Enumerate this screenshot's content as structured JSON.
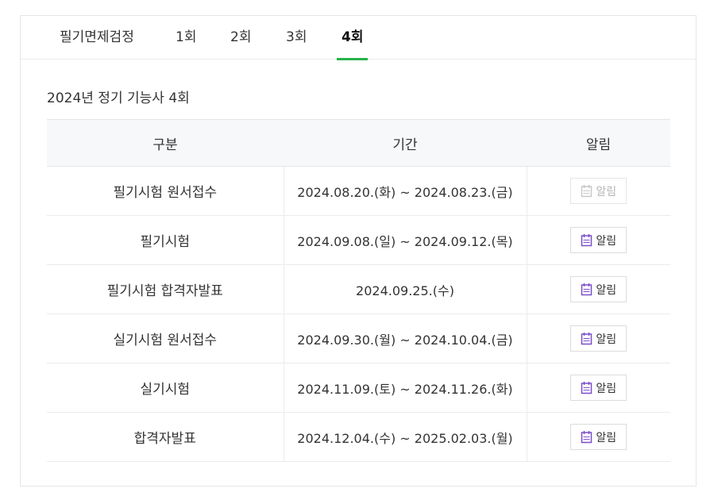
{
  "tabs": [
    {
      "label": "필기면제검정",
      "active": false
    },
    {
      "label": "1회",
      "active": false
    },
    {
      "label": "2회",
      "active": false
    },
    {
      "label": "3회",
      "active": false
    },
    {
      "label": "4회",
      "active": true
    }
  ],
  "section_title": "2024년 정기 기능사 4회",
  "table": {
    "headers": [
      "구분",
      "기간",
      "알림"
    ],
    "rows": [
      {
        "category": "필기시험 원서접수",
        "period": "2024.08.20.(화) ~ 2024.08.23.(금)",
        "alarm_label": "알림",
        "alarm_enabled": false
      },
      {
        "category": "필기시험",
        "period": "2024.09.08.(일) ~ 2024.09.12.(목)",
        "alarm_label": "알림",
        "alarm_enabled": true
      },
      {
        "category": "필기시험 합격자발표",
        "period": "2024.09.25.(수)",
        "alarm_label": "알림",
        "alarm_enabled": true
      },
      {
        "category": "실기시험 원서접수",
        "period": "2024.09.30.(월) ~ 2024.10.04.(금)",
        "alarm_label": "알림",
        "alarm_enabled": true
      },
      {
        "category": "실기시험",
        "period": "2024.11.09.(토) ~ 2024.11.26.(화)",
        "alarm_label": "알림",
        "alarm_enabled": true
      },
      {
        "category": "합격자발표",
        "period": "2024.12.04.(수) ~ 2025.02.03.(월)",
        "alarm_label": "알림",
        "alarm_enabled": true
      }
    ]
  },
  "colors": {
    "active_tab_underline": "#27b34a",
    "calendar_icon_active": "#7b4fc9",
    "calendar_icon_disabled": "#c8c8c8",
    "header_background": "#f7f8fa"
  },
  "icons": {
    "alarm": "calendar-icon"
  }
}
